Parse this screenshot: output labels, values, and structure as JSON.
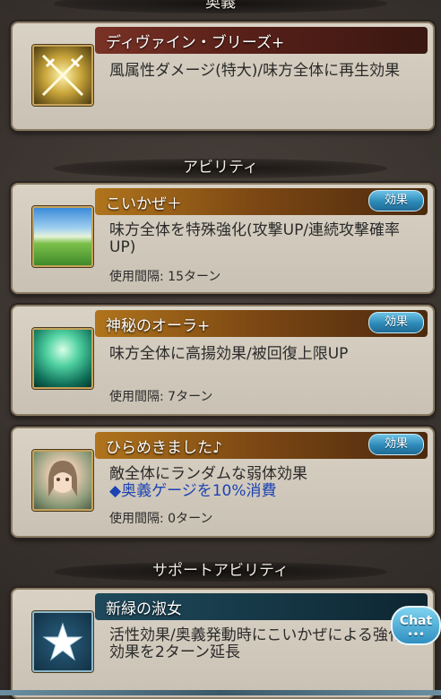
{
  "ougi_header": "奥義",
  "ability_header": "アビリティ",
  "support_header": "サポートアビリティ",
  "ougi": {
    "name": "ディヴァイン・ブリーズ+",
    "description": "風属性ダメージ(特大)/味方全体に再生効果",
    "icon": "crossed-swords-icon"
  },
  "abilities": [
    {
      "name": "こいかぜ＋",
      "description": "味方全体を特殊強化(攻撃UP/連続攻撃確率UP)",
      "interval": "使用間隔: 15ターン",
      "button": "効果",
      "icon": "green-field-icon"
    },
    {
      "name": "神秘のオーラ+",
      "description": "味方全体に高揚効果/被回復上限UP",
      "interval": "使用間隔: 7ターン",
      "button": "効果",
      "icon": "green-aura-icon"
    },
    {
      "name": "ひらめきました♪",
      "description": "敵全体にランダムな弱体効果",
      "cost_note": "◆奥義ゲージを10%消費",
      "interval": "使用間隔: 0ターン",
      "button": "効果",
      "icon": "character-portrait-icon"
    }
  ],
  "support": {
    "name": "新緑の淑女",
    "description": "活性効果/奥義発動時にこいかぜによる強化効果を2ターン延長",
    "icon": "star-icon"
  },
  "chat": {
    "label": "Chat",
    "dots": "•••"
  },
  "colors": {
    "effect_button": "#2d8ab8",
    "cost_note": "#1c43b3"
  }
}
